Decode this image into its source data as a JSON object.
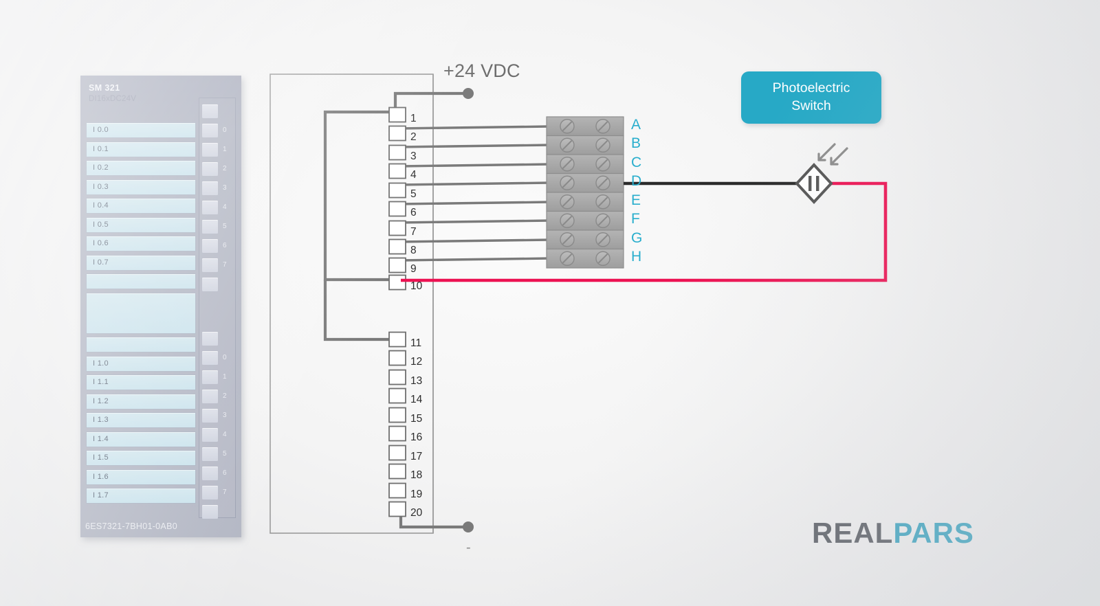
{
  "module": {
    "title": "SM 321",
    "subtitle": "DI16xDC24V",
    "part_number": "6ES7321-7BH01-0AB0",
    "channels_group1": [
      "I 0.0",
      "I 0.1",
      "I 0.2",
      "I 0.3",
      "I 0.4",
      "I 0.5",
      "I 0.6",
      "I 0.7"
    ],
    "channels_group2": [
      "I 1.0",
      "I 1.1",
      "I 1.2",
      "I 1.3",
      "I 1.4",
      "I 1.5",
      "I 1.6",
      "I 1.7"
    ],
    "led_labels_group1": [
      "0",
      "1",
      "2",
      "3",
      "4",
      "5",
      "6",
      "7"
    ],
    "led_labels_group2": [
      "0",
      "1",
      "2",
      "3",
      "4",
      "5",
      "6",
      "7"
    ],
    "body_color": "#aeb2c0",
    "channel_color": "#cde4ed"
  },
  "connector": {
    "terminal_numbers": [
      "1",
      "2",
      "3",
      "4",
      "5",
      "6",
      "7",
      "8",
      "9",
      "10",
      "11",
      "12",
      "13",
      "14",
      "15",
      "16",
      "17",
      "18",
      "19",
      "20"
    ]
  },
  "terminal_block": {
    "letters": [
      "A",
      "B",
      "C",
      "D",
      "E",
      "F",
      "G",
      "H"
    ],
    "letter_color": "#29aecd",
    "screws_per_row": 2
  },
  "labels": {
    "supply_positive": "+24 VDC",
    "supply_negative": "-",
    "sensor_badge_line1": "Photoelectric",
    "sensor_badge_line2": "Switch",
    "badge_color": "#27a9c6"
  },
  "wiring": {
    "signal_wire_color": "#7a7a7a",
    "sensor_black_wire_color": "#2b2b2b",
    "sensor_red_wire_color": "#ec1252",
    "connected_terminal_block_row": "D",
    "connected_return_terminal": "10",
    "supply_terminal": "1",
    "common_terminals": [
      "1",
      "10",
      "11"
    ],
    "negative_terminal": "20",
    "signal_terminals": [
      "2",
      "3",
      "4",
      "5",
      "6",
      "7",
      "8",
      "9"
    ]
  },
  "logo": {
    "part_a": "REAL",
    "part_b": "PARS",
    "color_a": "#5b5f66",
    "color_b": "#3da3bf"
  }
}
